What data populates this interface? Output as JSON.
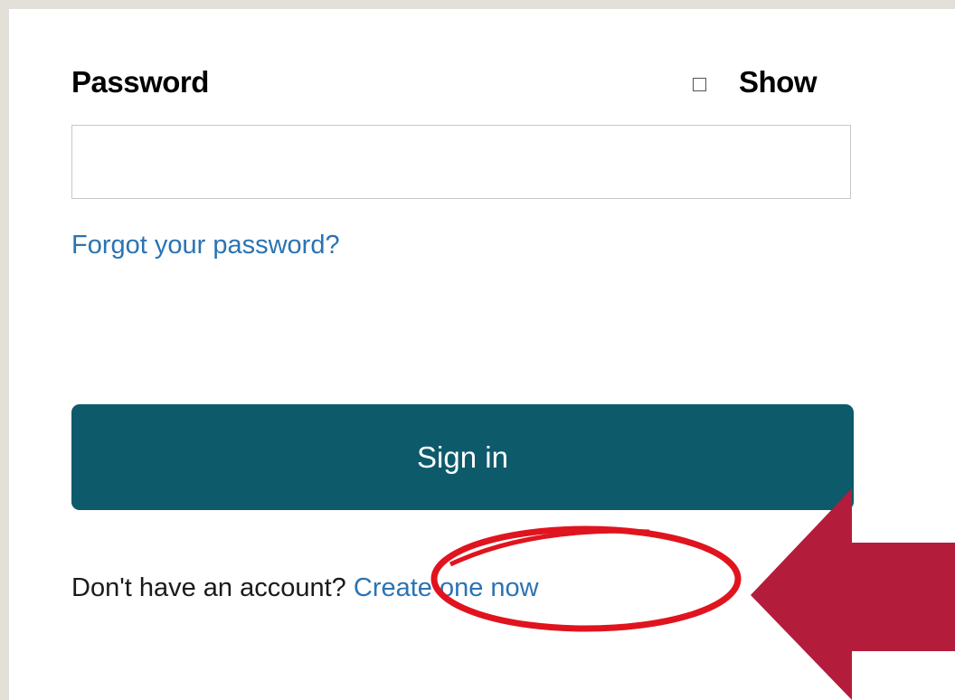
{
  "password": {
    "label": "Password",
    "show_label": "Show",
    "show_checked": false,
    "value": "",
    "placeholder": ""
  },
  "forgot_password_link": "Forgot your password?",
  "sign_in_button": "Sign in",
  "signup_prompt": {
    "text": "Don't have an account?",
    "link": "Create one now"
  },
  "colors": {
    "link": "#2b73b3",
    "button_bg": "#0d5a6b",
    "annotation_ellipse": "#e0141e",
    "annotation_arrow": "#b41c3c"
  },
  "icons": [
    "show-checkbox-icon",
    "annotation-arrow-icon"
  ]
}
